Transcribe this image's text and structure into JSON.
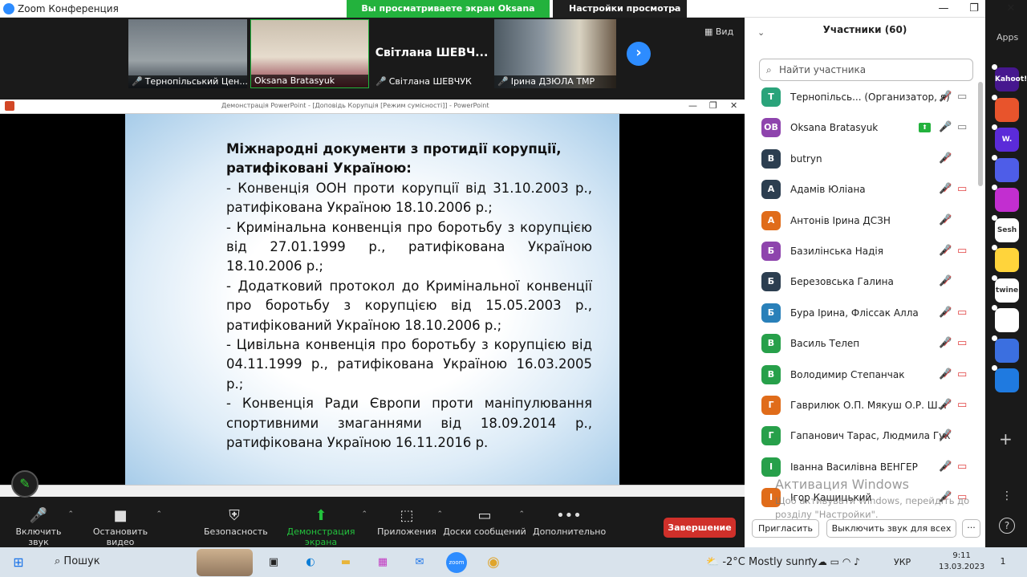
{
  "window": {
    "title": "Zoom Конференция"
  },
  "share_banner": "Вы просматриваете экран Oksana Bratasyuk",
  "view_options": "Настройки просмотра",
  "view_button": "Вид",
  "thumbnails": [
    {
      "label": "Тернопільський Цен..."
    },
    {
      "label": "Oksana Bratasyuk"
    },
    {
      "label": "Світлана ШЕВЧУК",
      "big_name": "Світлана ШЕВЧ..."
    },
    {
      "label": "Ірина ДЗЮЛА ТМР"
    }
  ],
  "ppt": {
    "title": "Демонстрація PowerPoint - [Доповідь Корупція [Режим сумісності]] - PowerPoint"
  },
  "slide": {
    "heading": "Міжнародні документи з протидії корупції, ратифіковані Україною:",
    "items": [
      "- Конвенція ООН проти корупції від 31.10.2003 р., ратифікована Україною 18.10.2006 р.;",
      "- Кримінальна конвенція про боротьбу з корупцією від 27.01.1999 р., ратифікована Україною 18.10.2006 р.;",
      "- Додатковий протокол до Кримінальної конвенції про боротьбу з корупцією від 15.05.2003 р., ратифікований Україною 18.10.2006 р.;",
      "- Цивільна конвенція про боротьбу з корупцією від 04.11.1999 р., ратифікована Україною 16.03.2005 р.;",
      "- Конвенція Ради Європи проти маніпулювання спортивними змаганнями від 18.09.2014 р., ратифікована Україною 16.11.2016 р."
    ]
  },
  "toolbar": {
    "unmute": "Включить звук",
    "stop_video": "Остановить видео",
    "security": "Безопасность",
    "share_screen": "Демонстрация экрана",
    "apps": "Приложения",
    "whiteboards": "Доски сообщений",
    "more": "Дополнительно",
    "end": "Завершение"
  },
  "participants": {
    "header": "Участники (60)",
    "search_placeholder": "Найти участника",
    "list": [
      {
        "initials": "Т",
        "name": "Тернопільсь...  (Организатор, я)",
        "color": "#2aa37a"
      },
      {
        "initials": "OB",
        "name": "Oksana Bratasyuk",
        "color": "#8e44ad"
      },
      {
        "initials": "B",
        "name": "butryn",
        "color": "#2c3e50"
      },
      {
        "initials": "А",
        "name": "Адамів Юліана",
        "color": "#2c3e50"
      },
      {
        "initials": "А",
        "name": "Антонів Ірина ДСЗН",
        "color": "#e06c1a"
      },
      {
        "initials": "Б",
        "name": "Базилінська Надія",
        "color": "#8e44ad"
      },
      {
        "initials": "Б",
        "name": "Березовська Галина",
        "color": "#2c3e50"
      },
      {
        "initials": "Б",
        "name": "Бура Ірина, Фліссак Алла",
        "color": "#2980b9"
      },
      {
        "initials": "В",
        "name": "Василь Телеп",
        "color": "#27a04a"
      },
      {
        "initials": "В",
        "name": "Володимир Степанчак",
        "color": "#27a04a"
      },
      {
        "initials": "Г",
        "name": "Гаврилюк О.П. Мякуш О.Р. Ш...",
        "color": "#e06c1a"
      },
      {
        "initials": "Г",
        "name": "Гапанович Тарас, Людмила Гук",
        "color": "#27a04a"
      },
      {
        "initials": "І",
        "name": "Іванна Василівна ВЕНГЕР",
        "color": "#27a04a"
      },
      {
        "initials": "І",
        "name": "Ігор Кашицький",
        "color": "#e06c1a"
      }
    ],
    "invite": "Пригласить",
    "mute_all": "Выключить звук для всех"
  },
  "watermark": {
    "title": "Активация Windows",
    "subtitle": "Щоб активувати Windows, перейдіть до розділу \"Настройки\"."
  },
  "apps_label": "Apps",
  "apps": [
    {
      "label": "Kahoot!",
      "color": "#46178f"
    },
    {
      "label": "",
      "color": "#e8542c"
    },
    {
      "label": "W.",
      "color": "#5b2bd9"
    },
    {
      "label": "",
      "color": "#4e5de8"
    },
    {
      "label": "",
      "color": "#c22ed0"
    },
    {
      "label": "Sesh",
      "color": "#ffffff"
    },
    {
      "label": "",
      "color": "#ffd43b"
    },
    {
      "label": "twine",
      "color": "#ffffff"
    },
    {
      "label": "",
      "color": "#ffffff"
    },
    {
      "label": "",
      "color": "#3b6fe0"
    },
    {
      "label": "",
      "color": "#1f7ae0"
    }
  ],
  "taskbar": {
    "search": "Пошук",
    "weather": "-2°C  Mostly sunny",
    "lang": "УКР",
    "time": "9:11",
    "date": "13.03.2023",
    "notif": "1"
  }
}
